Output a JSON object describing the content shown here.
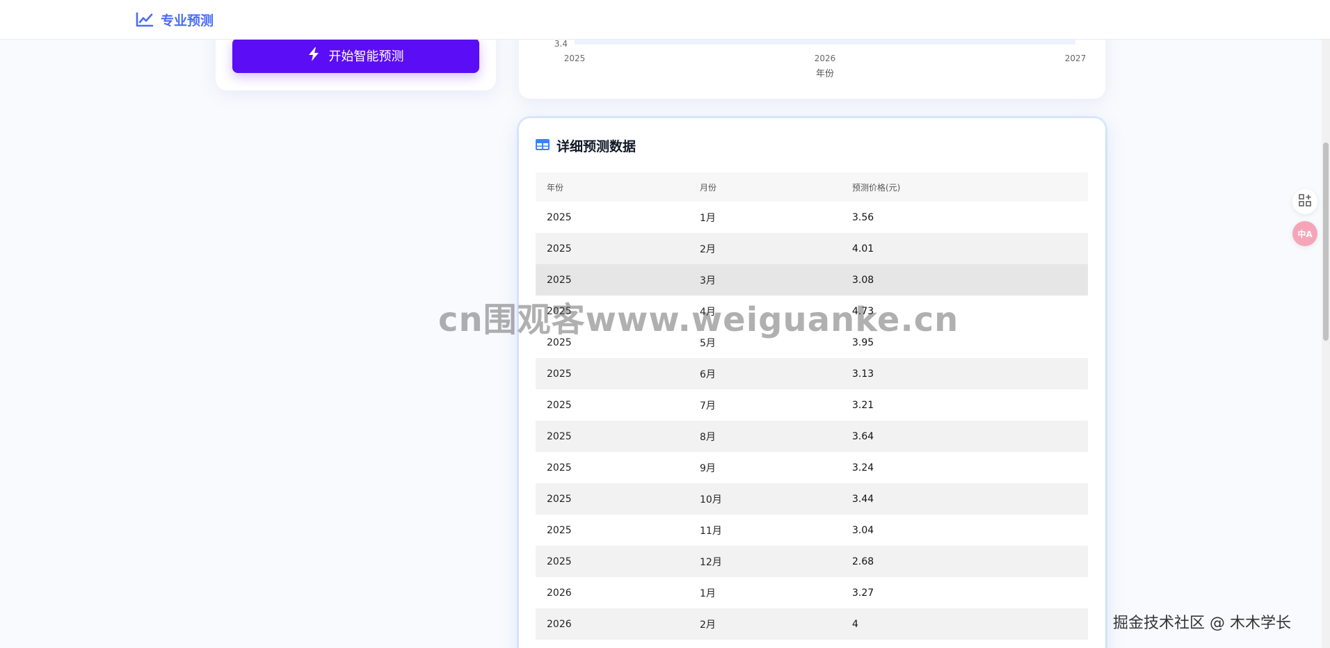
{
  "nav": {
    "brand": "专业预测",
    "brand_icon": "trend-chart-icon"
  },
  "left_panel": {
    "predict_button": "开始智能预测",
    "predict_icon": "lightning-bolt-icon"
  },
  "chart": {
    "y_tick": "3.4",
    "x_ticks": [
      "2025",
      "2026",
      "2027"
    ],
    "x_label": "年份"
  },
  "table": {
    "title": "详细预测数据",
    "title_icon": "table-icon",
    "columns": [
      "年份",
      "月份",
      "预测价格(元)"
    ],
    "rows": [
      {
        "year": "2025",
        "month": "1月",
        "price": "3.56"
      },
      {
        "year": "2025",
        "month": "2月",
        "price": "4.01"
      },
      {
        "year": "2025",
        "month": "3月",
        "price": "3.08"
      },
      {
        "year": "2025",
        "month": "4月",
        "price": "4.73"
      },
      {
        "year": "2025",
        "month": "5月",
        "price": "3.95"
      },
      {
        "year": "2025",
        "month": "6月",
        "price": "3.13"
      },
      {
        "year": "2025",
        "month": "7月",
        "price": "3.21"
      },
      {
        "year": "2025",
        "month": "8月",
        "price": "3.64"
      },
      {
        "year": "2025",
        "month": "9月",
        "price": "3.24"
      },
      {
        "year": "2025",
        "month": "10月",
        "price": "3.44"
      },
      {
        "year": "2025",
        "month": "11月",
        "price": "3.04"
      },
      {
        "year": "2025",
        "month": "12月",
        "price": "2.68"
      },
      {
        "year": "2026",
        "month": "1月",
        "price": "3.27"
      },
      {
        "year": "2026",
        "month": "2月",
        "price": "4"
      }
    ]
  },
  "side_tools": {
    "apps_icon": "apps-add-icon",
    "translate_icon": "translate-icon",
    "translate_label": "中A"
  },
  "watermark": "cn围观客www.weiguanke.cn",
  "credit": "掘金技术社区 @ 木木学长",
  "colors": {
    "brand": "#4a6cf7",
    "primary_button": "#5b0df5",
    "row_even": "#f2f2f2",
    "row_hover": "#e6e6e6"
  }
}
